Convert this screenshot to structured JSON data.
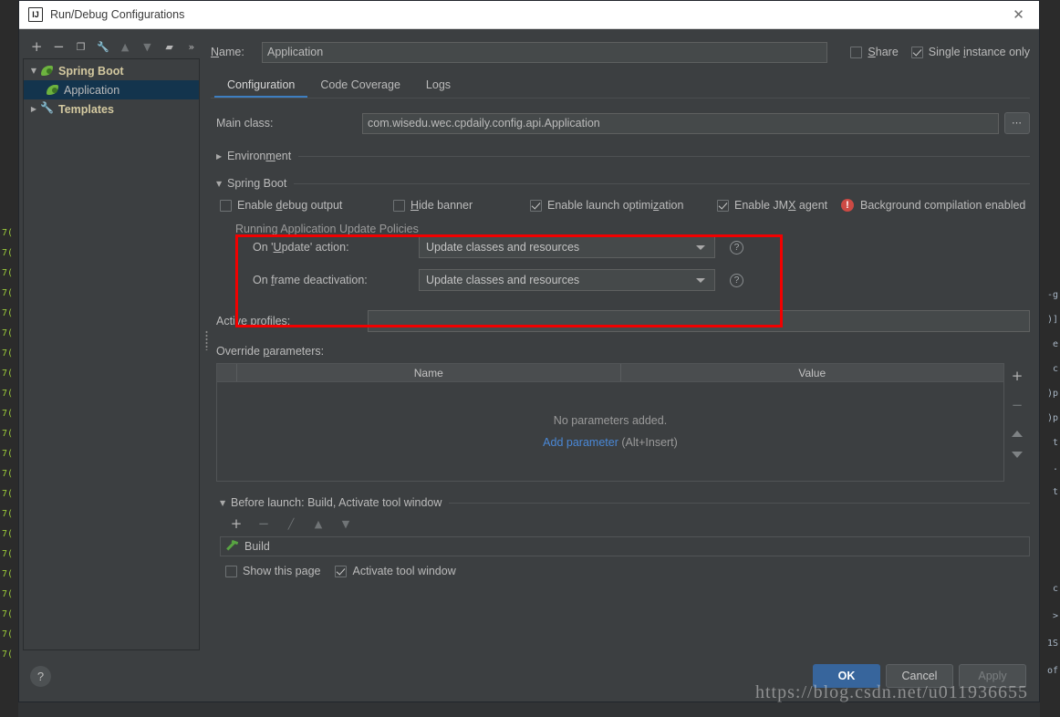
{
  "window": {
    "title": "Run/Debug Configurations",
    "app_icon": "intellij-idea-icon",
    "close_label": "✕"
  },
  "tree_toolbar": {
    "buttons": [
      {
        "name": "add-configuration-button",
        "glyph": "+",
        "enabled": true
      },
      {
        "name": "remove-configuration-button",
        "glyph": "−",
        "enabled": true
      },
      {
        "name": "copy-configuration-button",
        "glyph": "❐",
        "enabled": true
      },
      {
        "name": "edit-templates-button",
        "glyph": "🔧",
        "enabled": true
      },
      {
        "name": "move-up-button",
        "glyph": "▲",
        "enabled": false
      },
      {
        "name": "move-down-button",
        "glyph": "▼",
        "enabled": false
      },
      {
        "name": "new-folder-button",
        "glyph": "▰",
        "enabled": true
      },
      {
        "name": "more-options-button",
        "glyph": "»",
        "enabled": true
      }
    ]
  },
  "tree": {
    "items": [
      {
        "label": "Spring Boot",
        "icon": "spring-boot-icon",
        "expanded": true,
        "twisty": "▼",
        "selected": false,
        "level": 0
      },
      {
        "label": "Application",
        "icon": "spring-boot-icon",
        "twisty": "",
        "selected": true,
        "level": 1
      },
      {
        "label": "Templates",
        "icon": "wrench-icon",
        "expanded": false,
        "twisty": "▶",
        "selected": false,
        "level": 0
      }
    ]
  },
  "name_row": {
    "label": "Name:",
    "label_mnemonic": "N",
    "value": "Application",
    "placeholder": "",
    "share": {
      "label": "Share",
      "mnemonic": "S",
      "checked": false
    },
    "single_instance": {
      "label": "Single instance only",
      "mnemonic": "i",
      "checked": true
    }
  },
  "tabs": [
    {
      "label": "Configuration",
      "active": true
    },
    {
      "label": "Code Coverage",
      "active": false
    },
    {
      "label": "Logs",
      "active": false
    }
  ],
  "configuration": {
    "main_class": {
      "label": "Main class:",
      "value": "com.wisedu.wec.cpdaily.config.api.Application",
      "browse_label": "⋯"
    },
    "environment_section": {
      "label": "Environment",
      "mnemonic": "m",
      "expanded": false,
      "twisty": "▶"
    },
    "spring_boot_section": {
      "label": "Spring Boot",
      "mnemonic": "g",
      "expanded": true,
      "twisty": "▼"
    },
    "spring_boot_checkboxes": [
      {
        "label": "Enable debug output",
        "mnemonic": "d",
        "checked": false
      },
      {
        "label": "Hide banner",
        "mnemonic": "H",
        "checked": false
      },
      {
        "label": "Enable launch optimization",
        "mnemonic": "z",
        "checked": true
      },
      {
        "label": "Enable JMX agent",
        "mnemonic": "X",
        "checked": true
      }
    ],
    "background_warning": {
      "icon": "error-circle-icon",
      "text": "Background compilation enabled"
    },
    "update_policies": {
      "legend": "Running Application Update Policies",
      "highlight_color": "#f20000",
      "rows": [
        {
          "label": "On 'Update' action:",
          "mnemonic": "U",
          "value": "Update classes and resources",
          "help": "?"
        },
        {
          "label": "On frame deactivation:",
          "mnemonic": "f",
          "value": "Update classes and resources",
          "help": "?"
        }
      ]
    },
    "active_profiles": {
      "label": "Active profiles:",
      "value": "",
      "placeholder": ""
    },
    "override_parameters": {
      "label": "Override parameters:",
      "label_mnemonic": "p",
      "columns": [
        "Name",
        "Value"
      ],
      "rows": [],
      "empty_text": "No parameters added.",
      "add_link": "Add parameter",
      "add_shortcut": "(Alt+Insert)",
      "link_color": "#4a88d6",
      "side_buttons": [
        {
          "name": "add-parameter-button",
          "glyph": "+",
          "enabled": true
        },
        {
          "name": "remove-parameter-button",
          "glyph": "−",
          "enabled": false
        },
        {
          "name": "move-parameter-up-button",
          "glyph": "▲",
          "enabled": false
        },
        {
          "name": "move-parameter-down-button",
          "glyph": "▼",
          "enabled": false
        }
      ]
    }
  },
  "before_launch": {
    "header": "Before launch: Build, Activate tool window",
    "header_mnemonic": "B",
    "twisty": "▼",
    "toolbar": [
      {
        "name": "add-task-button",
        "glyph": "+",
        "enabled": true
      },
      {
        "name": "remove-task-button",
        "glyph": "−",
        "enabled": false
      },
      {
        "name": "edit-task-button",
        "glyph": "╱",
        "enabled": false
      },
      {
        "name": "move-task-up-button",
        "glyph": "▲",
        "enabled": false
      },
      {
        "name": "move-task-down-button",
        "glyph": "▼",
        "enabled": false
      }
    ],
    "tasks": [
      {
        "label": "Build",
        "icon": "hammer-icon"
      }
    ],
    "checkboxes": [
      {
        "label": "Show this page",
        "checked": false
      },
      {
        "label": "Activate tool window",
        "checked": true
      }
    ]
  },
  "footer": {
    "help_label": "?",
    "buttons": [
      {
        "label": "OK",
        "style": "primary",
        "enabled": true
      },
      {
        "label": "Cancel",
        "style": "default",
        "enabled": true
      },
      {
        "label": "Apply",
        "style": "default",
        "enabled": false
      }
    ]
  },
  "watermark": {
    "text": "https://blog.csdn.net/u011936655"
  }
}
